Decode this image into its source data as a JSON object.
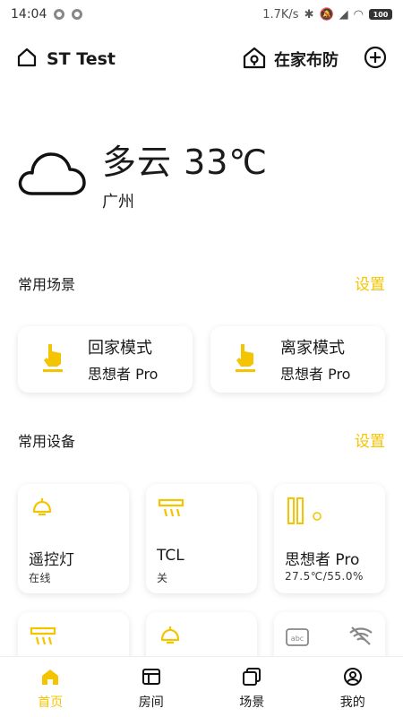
{
  "status_bar": {
    "time": "14:04",
    "network_speed": "1.7K/s",
    "battery": "100"
  },
  "header": {
    "home_name": "ST Test",
    "arm_mode": "在家布防"
  },
  "weather": {
    "summary": "多云 33℃",
    "city": "广州"
  },
  "scenes_section": {
    "title": "常用场景",
    "settings_label": "设置",
    "items": [
      {
        "name": "回家模式",
        "device": "思想者 Pro"
      },
      {
        "name": "离家模式",
        "device": "思想者 Pro"
      }
    ]
  },
  "devices_section": {
    "title": "常用设备",
    "settings_label": "设置",
    "items": [
      {
        "name": "遥控灯",
        "status": "在线",
        "icon": "lamp-icon"
      },
      {
        "name": "TCL",
        "status": "关",
        "icon": "air-conditioner-icon"
      },
      {
        "name": "思想者 Pro",
        "status": "27.5℃/55.0%",
        "icon": "sensor-icon"
      },
      {
        "icon": "air-conditioner-icon"
      },
      {
        "icon": "lamp-icon"
      },
      {
        "icon": "abc-remote-icon",
        "secondary_icon": "wifi-off-icon"
      }
    ]
  },
  "tab_bar": {
    "items": [
      {
        "label": "首页",
        "active": true
      },
      {
        "label": "房间",
        "active": false
      },
      {
        "label": "场景",
        "active": false
      },
      {
        "label": "我的",
        "active": false
      }
    ]
  },
  "colors": {
    "accent": "#f5c400",
    "text": "#1a1a1a",
    "card_bg": "#ffffff"
  }
}
